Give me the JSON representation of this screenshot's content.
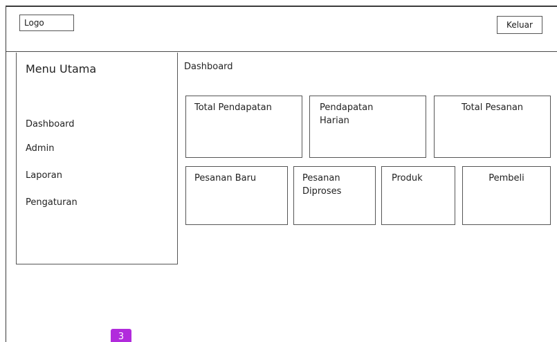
{
  "header": {
    "logo_label": "Logo",
    "logout_label": "Keluar"
  },
  "sidebar": {
    "title": "Menu Utama",
    "items": [
      {
        "label": "Dashboard"
      },
      {
        "label": "Admin"
      },
      {
        "label": "Laporan"
      },
      {
        "label": "Pengaturan"
      }
    ]
  },
  "main": {
    "title": "Dashboard",
    "stat_cards_row1": [
      {
        "label": "Total Pendapatan"
      },
      {
        "label": "Pendapatan\nHarian"
      },
      {
        "label": "Total Pesanan"
      }
    ],
    "stat_cards_row2": [
      {
        "label": "Pesanan Baru"
      },
      {
        "label": "Pesanan\nDiproses"
      },
      {
        "label": "Produk"
      },
      {
        "label": "Pembeli"
      }
    ]
  },
  "badge": {
    "value": "3",
    "color": "#b12bdc"
  }
}
